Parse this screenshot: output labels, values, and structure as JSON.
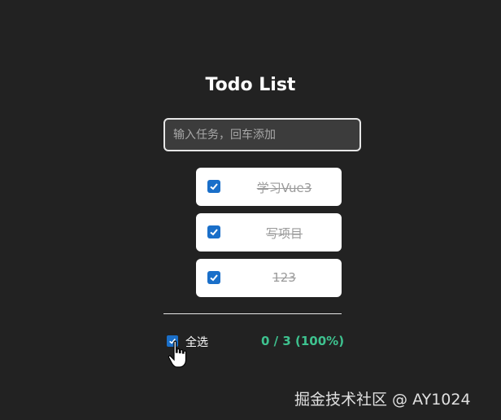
{
  "app": {
    "title": "Todo List"
  },
  "input": {
    "placeholder": "输入任务，回车添加",
    "value": ""
  },
  "todos": [
    {
      "text": "学习Vue3",
      "done": true
    },
    {
      "text": "写项目",
      "done": true
    },
    {
      "text": "123",
      "done": true
    }
  ],
  "footer": {
    "select_all_label": "全选",
    "select_all_checked": true,
    "stats": "0 / 3 (100%)"
  },
  "watermark": "掘金技术社区 @ AY1024",
  "colors": {
    "background": "#222222",
    "accent": "#3ec28f",
    "checkbox": "#1a6fc9"
  }
}
